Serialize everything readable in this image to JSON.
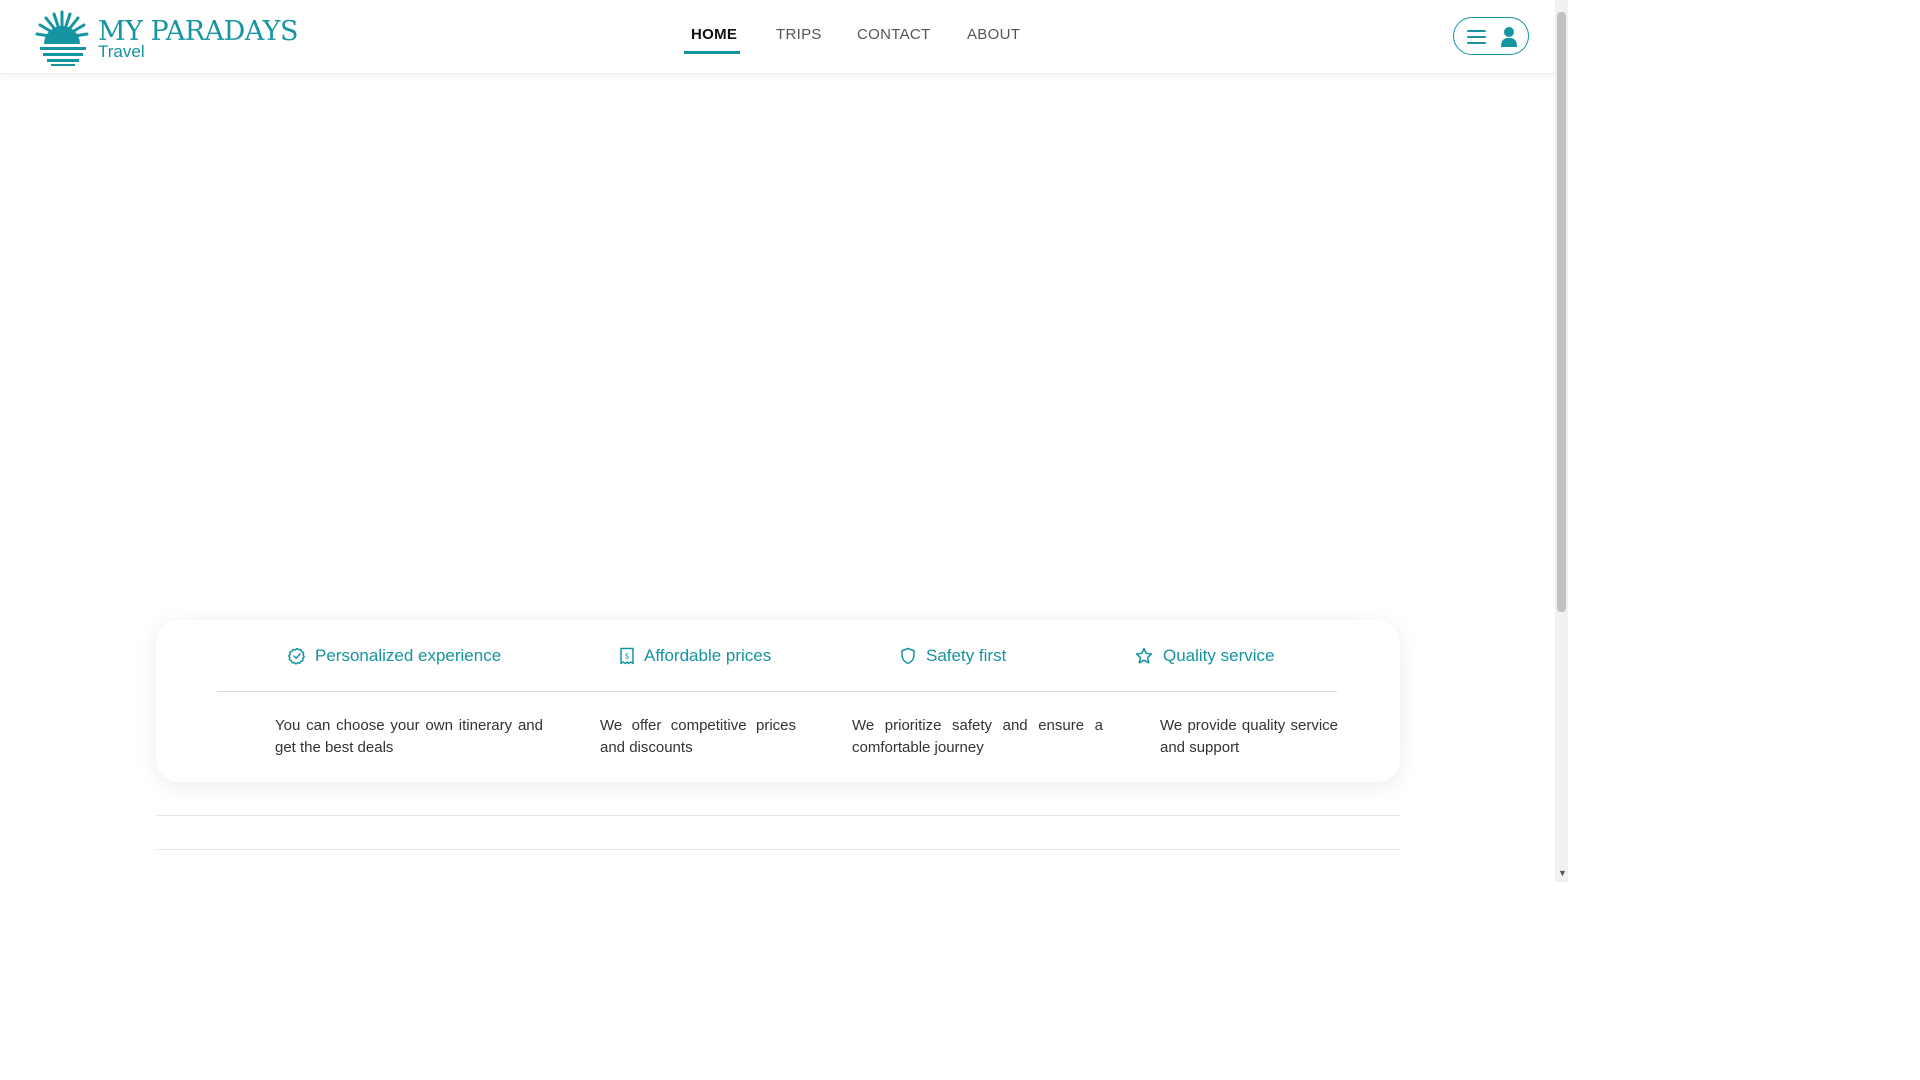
{
  "brand": {
    "name": "MY PARADAYS",
    "tagline": "Travel",
    "color": "#1594a1"
  },
  "nav": {
    "items": [
      {
        "label": "HOME",
        "active": true
      },
      {
        "label": "TRIPS",
        "active": false
      },
      {
        "label": "CONTACT",
        "active": false
      },
      {
        "label": "ABOUT",
        "active": false
      }
    ]
  },
  "user_menu": {
    "icons": [
      "hamburger-menu-icon",
      "user-icon"
    ]
  },
  "features": [
    {
      "icon": "badge-check-icon",
      "title": "Personalized experience",
      "description": "You can choose your own itinerary and get the best deals"
    },
    {
      "icon": "receipt-icon",
      "title": "Affordable prices",
      "description": "We offer competitive prices and discounts"
    },
    {
      "icon": "shield-icon",
      "title": "Safety first",
      "description": "We prioritize safety and ensure a comfortable journey"
    },
    {
      "icon": "star-icon",
      "title": "Quality service",
      "description": "We provide quality service and support"
    }
  ]
}
